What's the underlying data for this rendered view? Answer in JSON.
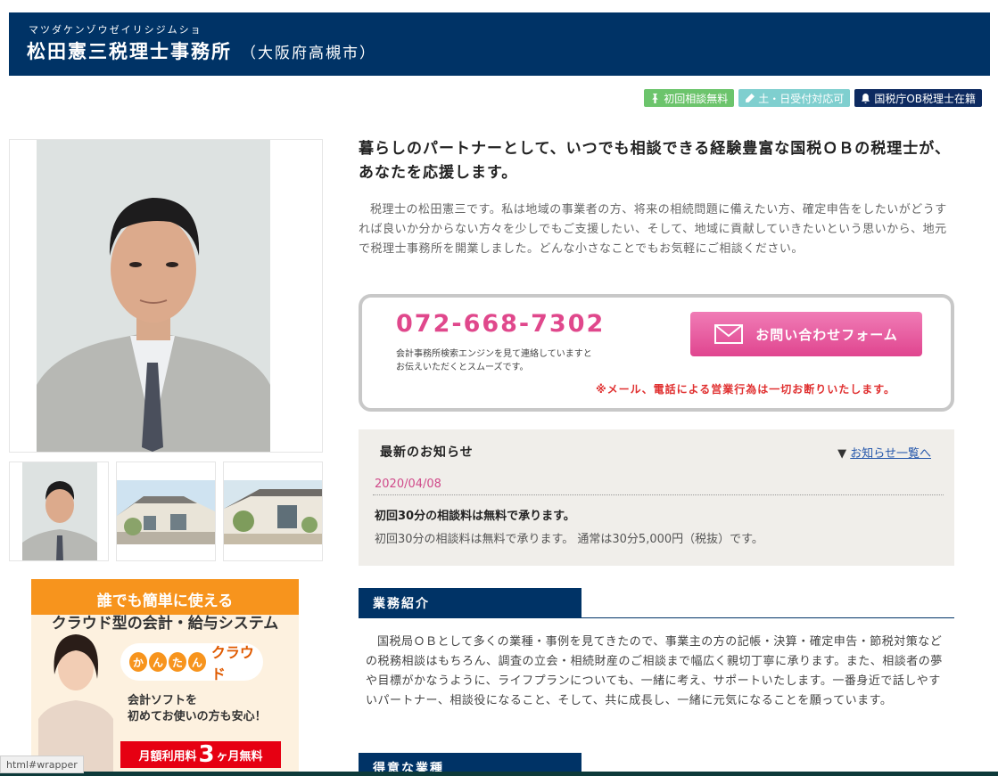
{
  "header": {
    "kana": "マツダケンゾウゼイリシジムショ",
    "title": "松田憲三税理士事務所",
    "area": "（大阪府高槻市）"
  },
  "badges": [
    {
      "label": "初回相談無料",
      "icon": "pin-icon",
      "color": "#6cc46c"
    },
    {
      "label": "土・日受付対応可",
      "icon": "pencil-icon",
      "color": "#7fcfcf"
    },
    {
      "label": "国税庁OB税理士在籍",
      "icon": "bell-icon",
      "color": "#0d2a60"
    }
  ],
  "headline": "暮らしのパートナーとして、いつでも相談できる経験豊富な国税ＯＢの税理士が、あなたを応援します。",
  "intro": "税理士の松田憲三です。私は地域の事業者の方、将来の相続問題に備えたい方、確定申告をしたいがどうすれば良いか分からない方々を少しでもご支援したい、そして、地域に貢献していきたいという思いから、地元で税理士事務所を開業しました。どんな小さなことでもお気軽にご相談ください。",
  "contact": {
    "phone": "072-668-7302",
    "note_line1": "会計事務所検索エンジンを見て連絡していますと",
    "note_line2": "お伝えいただくとスムーズです。",
    "form_button": "お問い合わせフォーム",
    "warning": "※メール、電話による営業行為は一切お断りいたします。"
  },
  "news": {
    "heading": "最新のお知らせ",
    "more_link": "お知らせ一覧へ",
    "items": [
      {
        "date": "2020/04/08",
        "title": "初回30分の相談料は無料で承ります。",
        "body": "初回30分の相談料は無料で承ります。 通常は30分5,000円（税抜）です。"
      }
    ]
  },
  "services": {
    "heading": "業務紹介",
    "body": "国税局ＯＢとして多くの業種・事例を見てきたので、事業主の方の記帳・決算・確定申告・節税対策などの税務相談はもちろん、調査の立会・相続財産のご相談まで幅広く親切丁寧に承ります。また、相談者の夢や目標がかなうように、ライフプランについても、一緒に考え、サポートいたします。一番身近で話しやすいパートナー、相談役になること、そして、共に成長し、一緒に元気になることを願っています。"
  },
  "specialty": {
    "heading": "得意な業種"
  },
  "ad": {
    "line1": "誰でも簡単に使える",
    "line2": "クラウド型の会計・給与システム",
    "brand_kana": [
      "か",
      "ん",
      "た",
      "ん"
    ],
    "brand_word": "クラウド",
    "copy_line1": "会計ソフトを",
    "copy_line2": "初めてお使いの方も安心！",
    "price_prefix": "月額利用料",
    "price_big": "3",
    "price_suffix": "ヶ月無料"
  },
  "statusbar": "html#wrapper"
}
